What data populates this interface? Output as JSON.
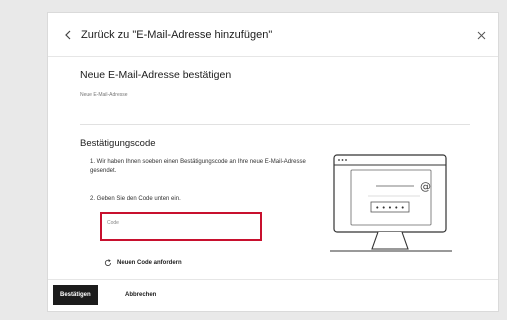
{
  "dialog": {
    "back_icon": "chevron-left-icon",
    "title": "Zurück zu \"E-Mail-Adresse hinzufügen\"",
    "close_icon": "close-icon"
  },
  "confirm_section": {
    "title": "Neue E-Mail-Adresse bestätigen",
    "email_label": "Neue E-Mail-Adresse"
  },
  "code_section": {
    "title": "Bestätigungscode",
    "step1": "1.  Wir haben Ihnen soeben einen Bestätigungscode an Ihre neue E-Mail-Adresse gesendet.",
    "step2": "2.  Geben Sie den Code unten ein.",
    "code_placeholder": "Code",
    "code_value": "",
    "resend_icon": "refresh-icon",
    "resend_label": "Neuen Code anfordern"
  },
  "illustration": {
    "icon": "monitor-email-icon",
    "at_symbol": "@",
    "code_mask": "• • • • •"
  },
  "footer": {
    "confirm_label": "Bestätigen",
    "cancel_label": "Abbrechen"
  },
  "colors": {
    "highlight": "#c8102e",
    "primary_button": "#1c1c1c"
  }
}
